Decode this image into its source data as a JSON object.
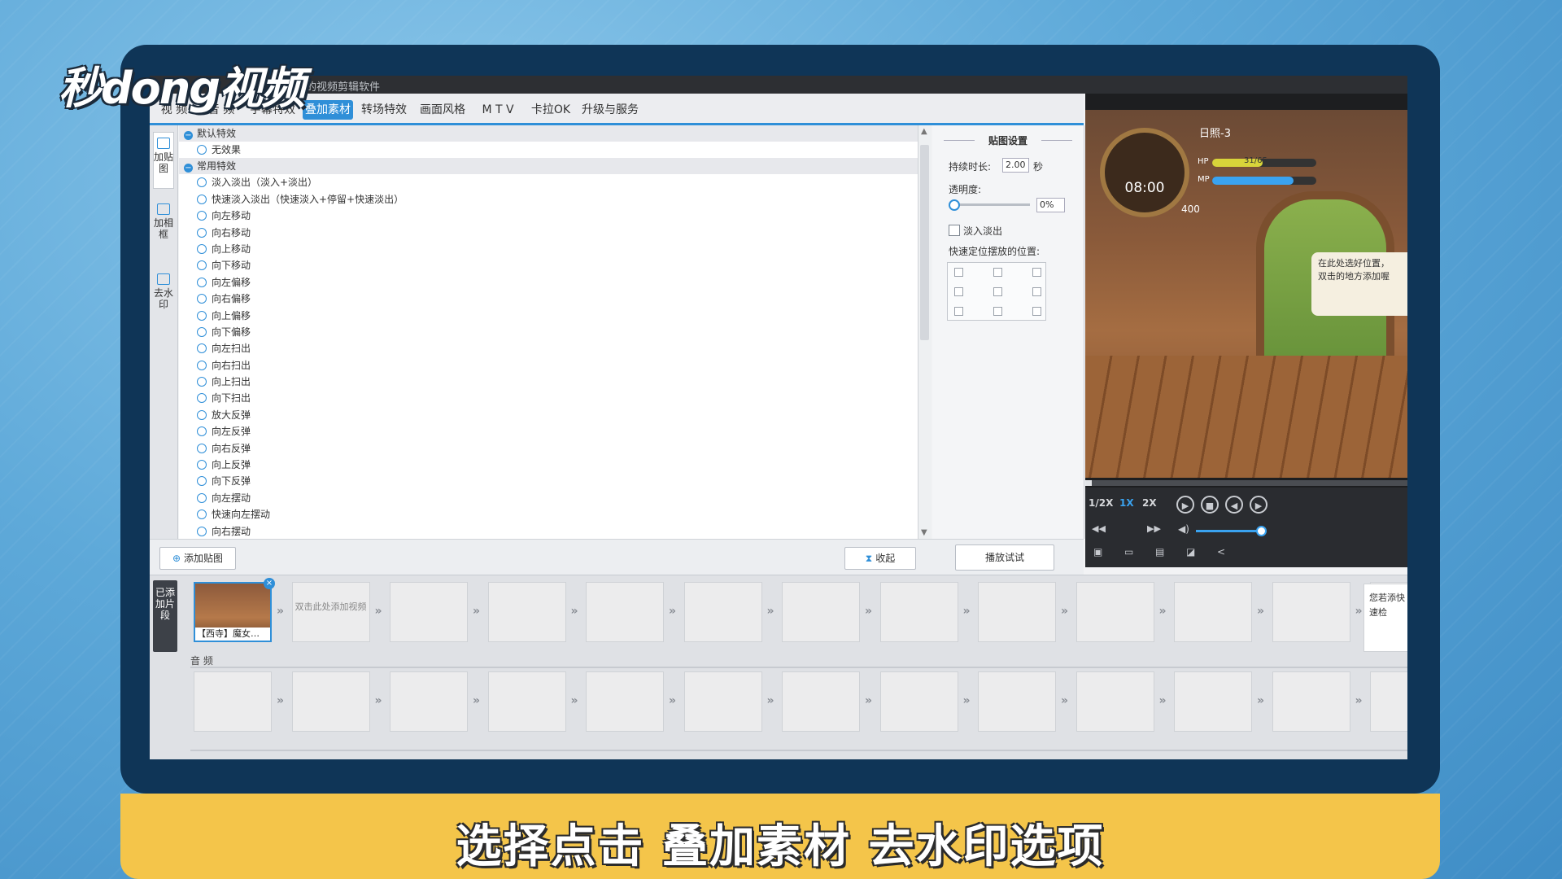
{
  "logo": "秒dong视频",
  "caption": "选择点击 叠加素材 去水印选项",
  "app": {
    "title": "强大的视频剪辑软件",
    "tabs": [
      "视 频",
      "音 频",
      "字幕特效",
      "叠加素材",
      "转场特效",
      "画面风格",
      "M T V",
      "卡拉OK",
      "升级与服务"
    ],
    "active_tab": "叠加素材"
  },
  "side_nav": [
    {
      "label": "加贴图",
      "icon": "sticker-icon"
    },
    {
      "label": "加相框",
      "icon": "frame-icon"
    },
    {
      "label": "去水印",
      "icon": "watermark-icon"
    }
  ],
  "effects": {
    "default_group": "默认特效",
    "default_items": [
      "无效果"
    ],
    "common_group": "常用特效",
    "common_items": [
      "淡入淡出（淡入+淡出）",
      "快速淡入淡出（快速淡入+停留+快速淡出）",
      "向左移动",
      "向右移动",
      "向上移动",
      "向下移动",
      "向左偏移",
      "向右偏移",
      "向上偏移",
      "向下偏移",
      "向左扫出",
      "向右扫出",
      "向上扫出",
      "向下扫出",
      "放大反弹",
      "向左反弹",
      "向右反弹",
      "向上反弹",
      "向下反弹",
      "向左摆动",
      "快速向左摆动",
      "向右摆动"
    ]
  },
  "sticker_settings": {
    "title": "贴图设置",
    "duration_label": "持续时长:",
    "duration_value": "2.00",
    "duration_unit": "秒",
    "opacity_label": "透明度:",
    "opacity_value": "0%",
    "fade_label": "淡入淡出",
    "position_label": "快速定位摆放的位置:",
    "preview_button": "播放试试"
  },
  "buttons": {
    "add_sticker": "添加贴图",
    "collapse": "收起"
  },
  "preview": {
    "level": "日照-3",
    "time": "08:00",
    "hp_label": "HP",
    "hp_value": "31/65",
    "mp_label": "MP",
    "coins": "400",
    "tooltip_line1": "在此处选好位置，",
    "tooltip_line2": "双击的地方添加喔",
    "speeds": [
      "1/2X",
      "1X",
      "2X"
    ],
    "active_speed": "1X",
    "progress": 0.02,
    "volume": 0.85
  },
  "timeline": {
    "clips_label": "已添加片段",
    "clip_name": "【西寺】魔女…",
    "empty_hint": "双击此处添加视频",
    "audio_label": "音 频",
    "side_hint": "您若添快速检"
  }
}
